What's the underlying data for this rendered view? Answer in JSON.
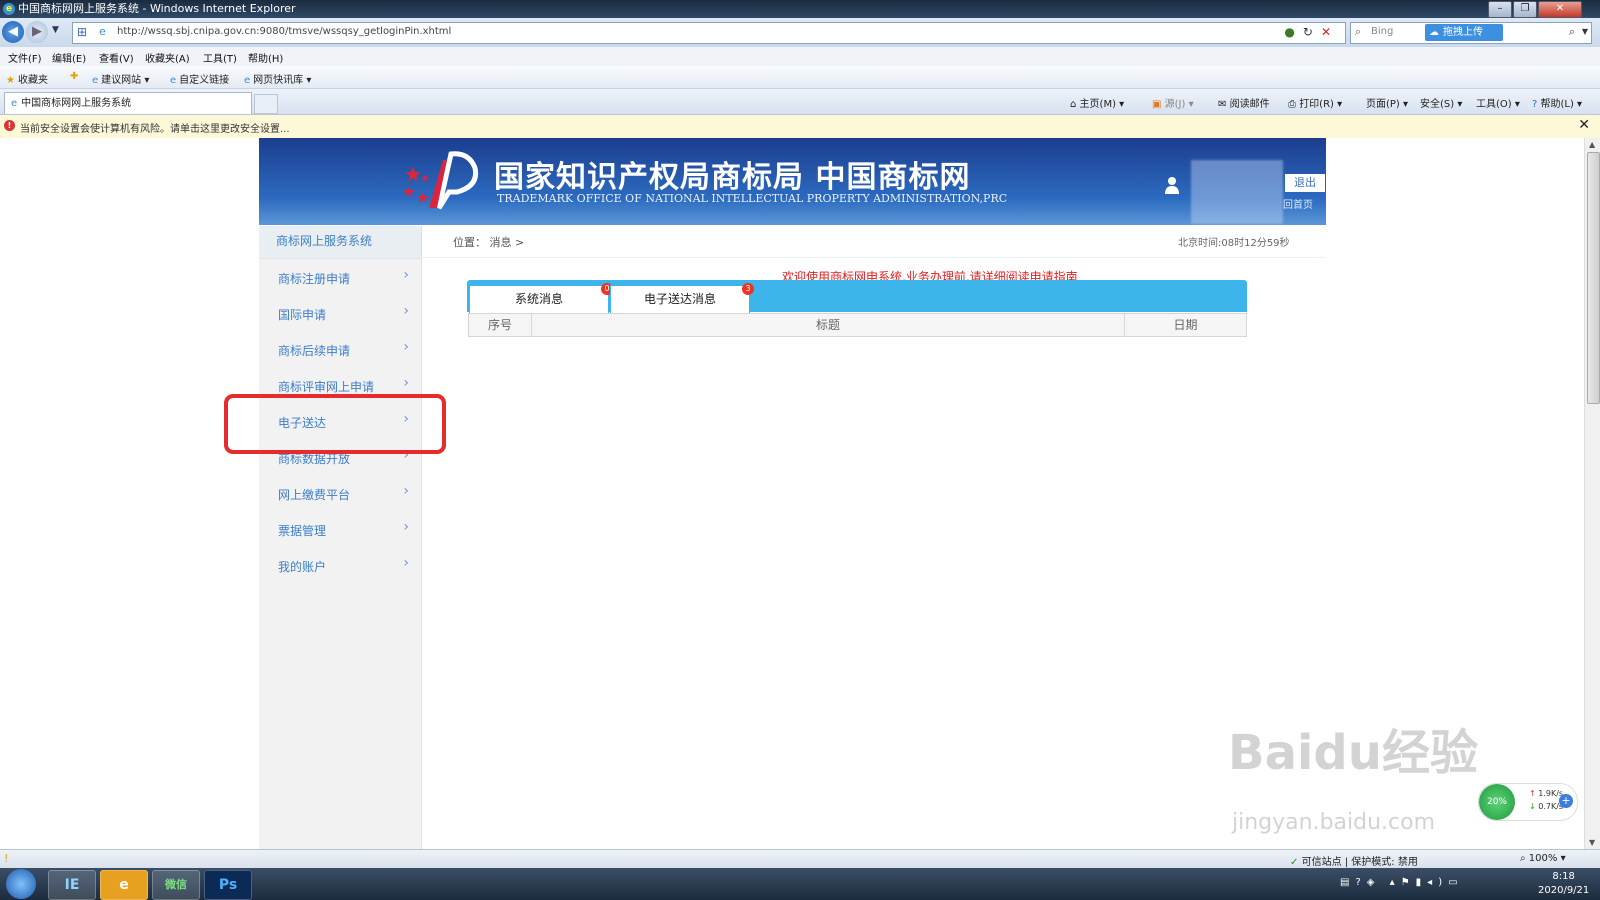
{
  "window": {
    "title": "中国商标网网上服务系统 - Windows Internet Explorer",
    "controls": [
      "–",
      "❐",
      "✕"
    ]
  },
  "address": {
    "url": "http://wssq.sbj.cnipa.gov.cn:9080/tmsve/wssqsy_getloginPin.xhtml",
    "search_engine": "Bing",
    "upload_label": "拖拽上传"
  },
  "menubar": [
    "文件(F)",
    "编辑(E)",
    "查看(V)",
    "收藏夹(A)",
    "工具(T)",
    "帮助(H)"
  ],
  "favorites": [
    "收藏夹",
    "建议网站",
    "自定义链接",
    "网页快讯库"
  ],
  "tab": {
    "title": "中国商标网网上服务系统"
  },
  "commands": [
    "主页(M)",
    "源(J)",
    "阅读邮件",
    "打印(R)",
    "页面(P)",
    "安全(S)",
    "工具(O)",
    "帮助(L)"
  ],
  "infobar": {
    "text": "当前安全设置会使计算机有风险。请单击这里更改安全设置..."
  },
  "site": {
    "title": "国家知识产权局商标局 中国商标网",
    "subtitle": "TRADEMARK OFFICE OF NATIONAL INTELLECTUAL PROPERTY ADMINISTRATION,PRC",
    "logout": "退出",
    "home": "回首页"
  },
  "sidebar": {
    "title": "商标网上服务系统",
    "items": [
      {
        "label": "商标注册申请"
      },
      {
        "label": "国际申请"
      },
      {
        "label": "商标后续申请"
      },
      {
        "label": "商标评审网上申请"
      },
      {
        "label": "电子送达"
      },
      {
        "label": "商标数据开放"
      },
      {
        "label": "网上缴费平台"
      },
      {
        "label": "票据管理"
      },
      {
        "label": "我的账户"
      }
    ]
  },
  "main": {
    "breadcrumb": "位置： 消息 >",
    "clock": "北京时间:08时12分59秒",
    "welcome": "欢迎使用商标网申系统,业务办理前,请详细阅读申请指南",
    "tabs": [
      {
        "label": "系统消息",
        "badge": "0"
      },
      {
        "label": "电子送达消息",
        "badge": "3"
      }
    ],
    "columns": [
      "序号",
      "标题",
      "日期"
    ]
  },
  "watermark": {
    "text": "Baidu经验",
    "sub": "jingyan.baidu.com"
  },
  "network": {
    "up": "1.9K/s",
    "down": "0.7K/s",
    "percent": "20%"
  },
  "statusbar": {
    "trusted": "可信站点 | 保护模式: 禁用",
    "zoom": "100%"
  },
  "taskbar": {
    "apps": [
      "IE",
      "e",
      "微信",
      "Ps"
    ],
    "time": "8:18",
    "date": "2020/9/21"
  },
  "colors": {
    "accent": "#3db4ea",
    "sidebar_text": "#3d7ec9",
    "highlight": "#e52b2b",
    "welcome": "#e02020"
  }
}
